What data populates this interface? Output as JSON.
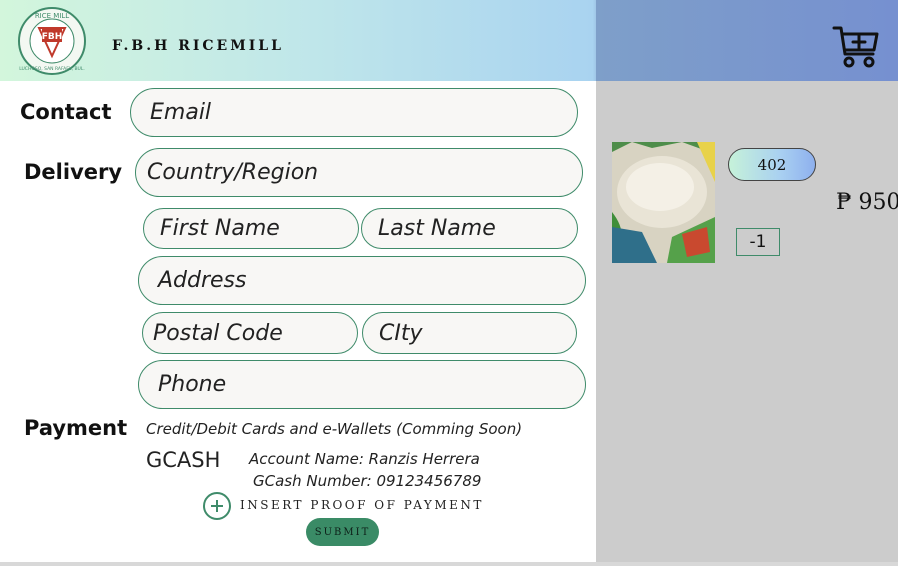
{
  "header": {
    "brand": "F.B.H RICEMILL",
    "logo": {
      "top_text": "RICE     MILL",
      "center_text": "FBH",
      "bottom_text": "LUCHOSO, SAN RAFAEL, BUL."
    },
    "colors": {
      "gradient_start": "#d3f6dc",
      "gradient_mid": "#a9d3f0",
      "cart_panel": "#7690d0"
    }
  },
  "form": {
    "contact": {
      "label": "Contact",
      "email_placeholder": "Email"
    },
    "delivery": {
      "label": "Delivery",
      "country_placeholder": "Country/Region",
      "first_name_placeholder": "First Name",
      "last_name_placeholder": "Last Name",
      "address_placeholder": "Address",
      "postal_code_placeholder": "Postal Code",
      "city_placeholder": "CIty",
      "phone_placeholder": "Phone"
    },
    "payment": {
      "label": "Payment",
      "cards_note": "Credit/Debit Cards and e-Wallets (Comming Soon)",
      "gcash_label": "GCASH",
      "account_name": "Account Name: Ranzis Herrera",
      "gcash_number": "GCash Number: 09123456789",
      "insert_proof_label": "INSERT PROOF OF PAYMENT",
      "submit_label": "SUBMIT"
    },
    "accent_color": "#3f8b6a"
  },
  "cart": {
    "item": {
      "image": "rice-sack-image",
      "quantity": "402",
      "price": "₱ 950",
      "decrement_label": "-1"
    },
    "panel_color": "#cccccc"
  }
}
